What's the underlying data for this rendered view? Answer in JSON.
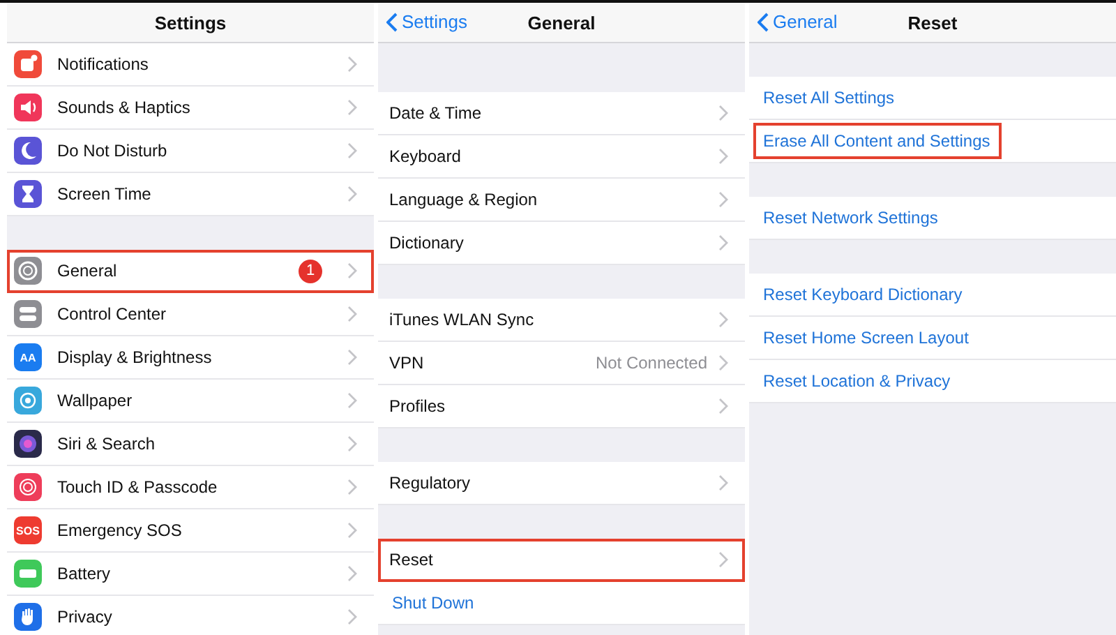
{
  "panels": [
    {
      "title": "Settings",
      "groups": [
        {
          "rows": [
            {
              "kind": "nav",
              "label": "Notifications",
              "color": "#f04a3a",
              "highlighted": false
            },
            {
              "kind": "nav",
              "label": "Sounds & Haptics",
              "color": "#f0365a",
              "highlighted": false
            },
            {
              "kind": "nav",
              "label": "Do Not Disturb",
              "color": "#5a54d6",
              "highlighted": false
            },
            {
              "kind": "nav",
              "label": "Screen Time",
              "color": "#5a54d6",
              "highlighted": false
            }
          ]
        },
        {
          "rows": [
            {
              "kind": "nav",
              "label": "General",
              "color": "#8e8e93",
              "badge": "1",
              "highlighted": true
            },
            {
              "kind": "nav",
              "label": "Control Center",
              "color": "#8e8e93",
              "highlighted": false
            },
            {
              "kind": "nav",
              "label": "Display & Brightness",
              "color": "#1a7cf0",
              "icon_label": "AA",
              "highlighted": false
            },
            {
              "kind": "nav",
              "label": "Wallpaper",
              "color": "#38a8dc",
              "highlighted": false
            },
            {
              "kind": "nav",
              "label": "Siri & Search",
              "color": "#2a2a4a",
              "highlighted": false
            },
            {
              "kind": "nav",
              "label": "Touch ID & Passcode",
              "color": "#ee3d5a",
              "highlighted": false
            },
            {
              "kind": "nav",
              "label": "Emergency SOS",
              "color": "#ee3b30",
              "icon_label": "SOS",
              "highlighted": false
            },
            {
              "kind": "nav",
              "label": "Battery",
              "color": "#3fc95a",
              "highlighted": false
            },
            {
              "kind": "nav",
              "label": "Privacy",
              "color": "#1f6fe8",
              "highlighted": false
            }
          ]
        }
      ]
    },
    {
      "title": "General",
      "back": "Settings",
      "groups": [
        {
          "rows": [
            {
              "kind": "nav",
              "label": "Date & Time",
              "highlighted": false
            },
            {
              "kind": "nav",
              "label": "Keyboard",
              "highlighted": false
            },
            {
              "kind": "nav",
              "label": "Language & Region",
              "highlighted": false
            },
            {
              "kind": "nav",
              "label": "Dictionary",
              "highlighted": false
            }
          ]
        },
        {
          "rows": [
            {
              "kind": "nav",
              "label": "iTunes WLAN Sync",
              "highlighted": false
            },
            {
              "kind": "nav",
              "label": "VPN",
              "value": "Not Connected",
              "highlighted": false
            },
            {
              "kind": "nav",
              "label": "Profiles",
              "highlighted": false
            }
          ]
        },
        {
          "rows": [
            {
              "kind": "nav",
              "label": "Regulatory",
              "highlighted": false
            }
          ]
        },
        {
          "rows": [
            {
              "kind": "nav",
              "label": "Reset",
              "highlighted": true
            },
            {
              "kind": "action",
              "label": "Shut Down",
              "highlighted": false
            }
          ]
        }
      ]
    },
    {
      "title": "Reset",
      "back": "General",
      "groups": [
        {
          "rows": [
            {
              "kind": "action",
              "label": "Reset All Settings",
              "highlighted": false
            },
            {
              "kind": "action",
              "label": "Erase All Content and Settings",
              "highlighted": true
            }
          ]
        },
        {
          "rows": [
            {
              "kind": "action",
              "label": "Reset Network Settings",
              "highlighted": false
            }
          ]
        },
        {
          "rows": [
            {
              "kind": "action",
              "label": "Reset Keyboard Dictionary",
              "highlighted": false
            },
            {
              "kind": "action",
              "label": "Reset Home Screen Layout",
              "highlighted": false
            },
            {
              "kind": "action",
              "label": "Reset Location & Privacy",
              "highlighted": false
            }
          ]
        }
      ]
    }
  ]
}
